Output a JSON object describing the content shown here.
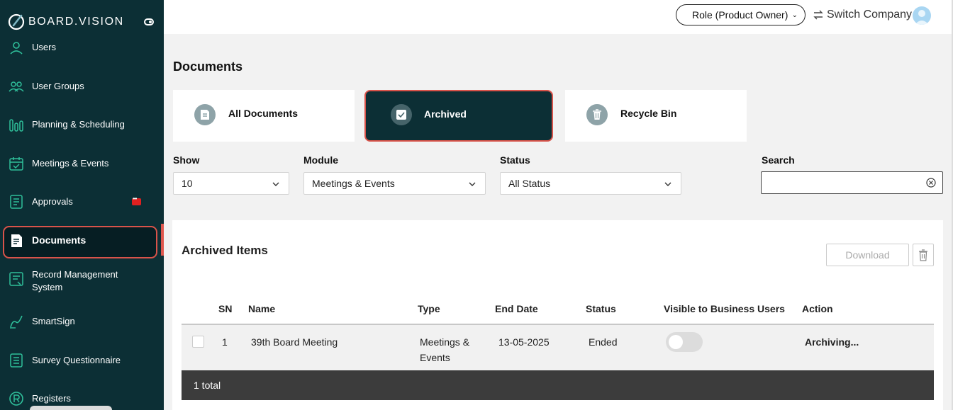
{
  "brand": {
    "name": "BOARD.VISION"
  },
  "sidebar": {
    "items": [
      {
        "label": "Users",
        "icon": "user-icon"
      },
      {
        "label": "User Groups",
        "icon": "user-group-icon"
      },
      {
        "label": "Planning & Scheduling",
        "icon": "planning-icon"
      },
      {
        "label": "Meetings & Events",
        "icon": "calendar-icon"
      },
      {
        "label": "Approvals",
        "icon": "approval-icon"
      },
      {
        "label": "Documents",
        "icon": "document-icon",
        "active": true
      },
      {
        "label": "Record Management System",
        "icon": "record-icon"
      },
      {
        "label": "SmartSign",
        "icon": "signature-icon"
      },
      {
        "label": "Survey Questionnaire",
        "icon": "survey-icon"
      },
      {
        "label": "Registers",
        "icon": "registered-icon"
      }
    ]
  },
  "topbar": {
    "role_label": "Role (Product Owner)",
    "switch_label": "Switch Company"
  },
  "page": {
    "title": "Documents"
  },
  "tabs": [
    {
      "label": "All Documents",
      "icon": "document-icon"
    },
    {
      "label": "Archived",
      "icon": "checkbox-icon",
      "active": true
    },
    {
      "label": "Recycle Bin",
      "icon": "trash-icon"
    }
  ],
  "filters": {
    "show": {
      "label": "Show",
      "value": "10"
    },
    "module": {
      "label": "Module",
      "value": "Meetings & Events"
    },
    "status": {
      "label": "Status",
      "value": "All Status"
    },
    "search": {
      "label": "Search",
      "value": ""
    }
  },
  "panel": {
    "title": "Archived Items",
    "download_label": "Download",
    "columns": [
      "SN",
      "Name",
      "Type",
      "End Date",
      "Status",
      "Visible to Business Users",
      "Action"
    ],
    "rows": [
      {
        "sn": "1",
        "name": "39th Board Meeting",
        "type_line1": "Meetings &",
        "type_line2": "Events",
        "end_date": "13-05-2025",
        "status": "Ended",
        "visible": false,
        "action": "Archiving..."
      }
    ],
    "footer": "1 total"
  },
  "colors": {
    "sidebar_bg": "#0c2f35",
    "accent": "#d9534a"
  }
}
